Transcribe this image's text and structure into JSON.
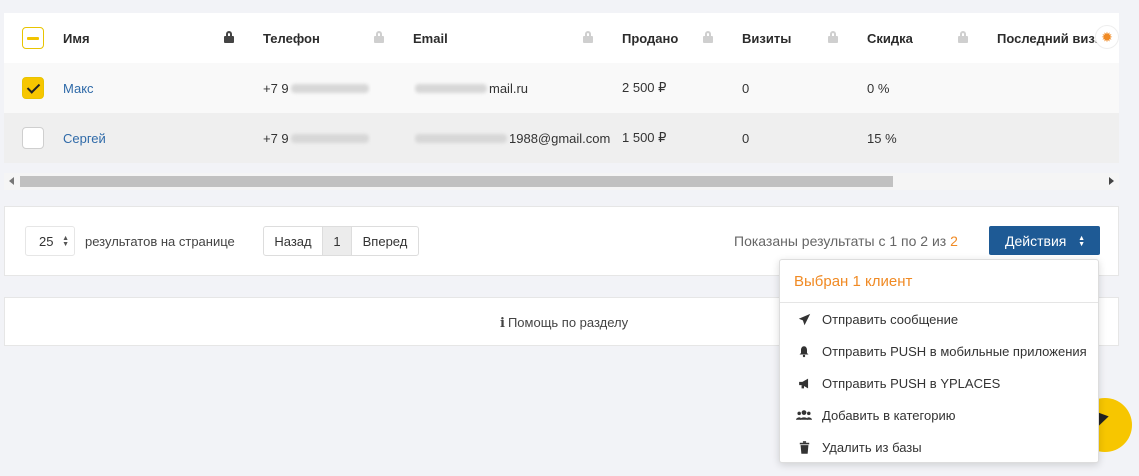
{
  "table": {
    "columns": [
      {
        "key": "name",
        "label": "Имя"
      },
      {
        "key": "phone",
        "label": "Телефон"
      },
      {
        "key": "email",
        "label": "Email"
      },
      {
        "key": "sold",
        "label": "Продано"
      },
      {
        "key": "visits",
        "label": "Визиты"
      },
      {
        "key": "discount",
        "label": "Скидка"
      },
      {
        "key": "last_visit",
        "label": "Последний визит"
      }
    ],
    "rows": [
      {
        "checked": true,
        "name": "Макс",
        "phone_prefix": "+7 9",
        "email_suffix": "mail.ru",
        "sold": "2 500 ₽",
        "visits": "0",
        "discount": "0 %"
      },
      {
        "checked": false,
        "name": "Сергей",
        "phone_prefix": "+7 9",
        "email_suffix": "1988@gmail.com",
        "sold": "1 500 ₽",
        "visits": "0",
        "discount": "15 %"
      }
    ]
  },
  "pager": {
    "per_page": "25",
    "per_page_label": "результатов на странице",
    "back": "Назад",
    "page": "1",
    "next": "Вперед",
    "results_prefix": "Показаны результаты с 1 по 2 из",
    "results_total": "2",
    "actions_label": "Действия"
  },
  "help": {
    "label": "Помощь по разделу"
  },
  "dropdown": {
    "header": "Выбран 1 клиент",
    "items": [
      {
        "icon": "paper-plane-icon",
        "label": "Отправить сообщение"
      },
      {
        "icon": "bell-icon",
        "label": "Отправить PUSH в мобильные приложения"
      },
      {
        "icon": "megaphone-icon",
        "label": "Отправить PUSH в YPLACES"
      },
      {
        "icon": "users-icon",
        "label": "Добавить в категорию"
      },
      {
        "icon": "trash-icon",
        "label": "Удалить из базы"
      }
    ]
  },
  "colors": {
    "accent_orange": "#f08a24",
    "primary_blue": "#1e5a95",
    "check_yellow": "#f7c600",
    "link_blue": "#2f6aa8"
  }
}
